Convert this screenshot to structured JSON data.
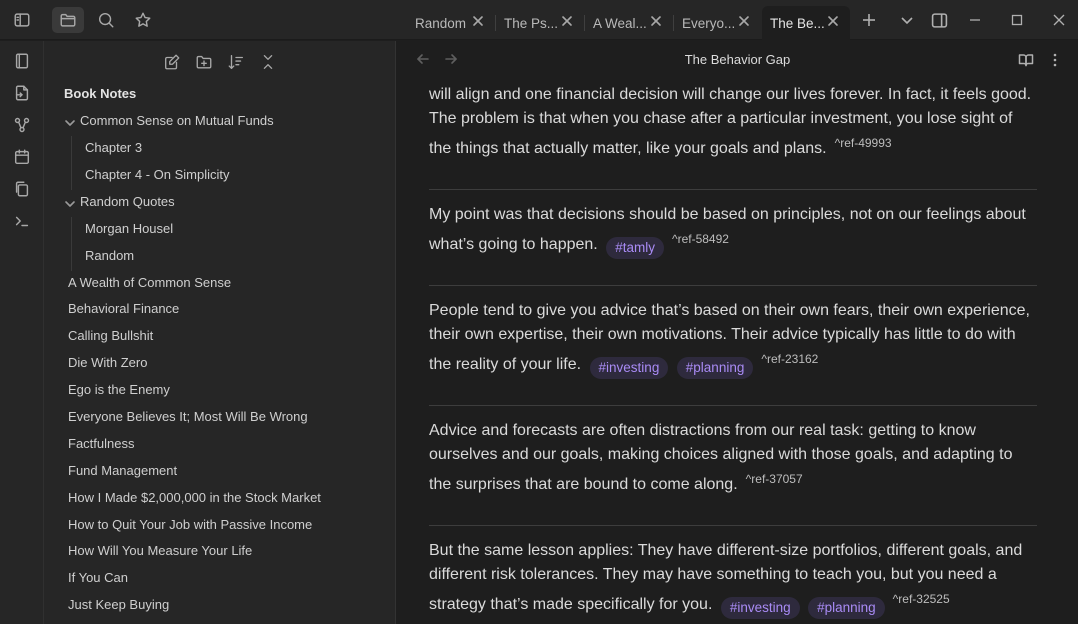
{
  "tabs": [
    {
      "label": "Random"
    },
    {
      "label": "The Ps..."
    },
    {
      "label": "A Weal..."
    },
    {
      "label": "Everyo..."
    },
    {
      "label": "The Be..."
    }
  ],
  "sidebar": {
    "root": "Book Notes",
    "items": [
      "Common Sense on Mutual Funds",
      "Chapter 3",
      "Chapter 4 - On Simplicity",
      "Random Quotes",
      "Morgan Housel",
      "Random",
      "A Wealth of Common Sense",
      "Behavioral Finance",
      "Calling Bullshit",
      "Die With Zero",
      "Ego is the Enemy",
      "Everyone Believes It; Most Will Be Wrong",
      "Factfulness",
      "Fund Management",
      "How I Made $2,000,000 in the Stock Market",
      "How to Quit Your Job with Passive Income",
      "How Will You Measure Your Life",
      "If You Can",
      "Just Keep Buying"
    ]
  },
  "main": {
    "title": "The Behavior Gap",
    "paragraphs": [
      {
        "text": "will align and one financial decision will change our lives forever. In fact, it feels good. The problem is that when you chase after a particular investment, you lose sight of the things that actually matter, like your goals and plans.",
        "tags": [],
        "ref": "^ref-49993"
      },
      {
        "text": "My point was that decisions should be based on principles, not on our feelings about what’s going to happen.",
        "tags": [
          "#tamly"
        ],
        "ref": "^ref-58492"
      },
      {
        "text": "People tend to give you advice that’s based on their own fears, their own experience, their own expertise, their own motivations. Their advice typically has little to do with the reality of your life.",
        "tags": [
          "#investing",
          "#planning"
        ],
        "ref": "^ref-23162"
      },
      {
        "text": "Advice and forecasts are often distractions from our real task: getting to know ourselves and our goals, making choices aligned with those goals, and adapting to the surprises that are bound to come along.",
        "tags": [],
        "ref": "^ref-37057"
      },
      {
        "text": "But the same lesson applies: They have different-size portfolios, different goals, and different risk tolerances. They may have something to teach you, but you need a strategy that’s made specifically for you.",
        "tags": [
          "#investing",
          "#planning"
        ],
        "ref": "^ref-32525"
      }
    ]
  },
  "colors": {
    "tag_text": "#a98bf5",
    "tag_bg": "#2e2a3d",
    "background": "#1e1e1e",
    "panel": "#262626"
  },
  "icons": {
    "topbar": [
      "sidebar-toggle-icon",
      "folder-icon",
      "search-icon",
      "star-icon",
      "new-tab-icon",
      "chevron-down-icon",
      "split-icon",
      "minimize-icon",
      "maximize-icon",
      "close-icon"
    ],
    "ribbon": [
      "files-icon",
      "open-file-icon",
      "graph-icon",
      "calendar-icon",
      "copy-icon",
      "terminal-icon"
    ],
    "sidebar_tools": [
      "new-note-icon",
      "new-folder-icon",
      "sort-icon",
      "collapse-icon"
    ],
    "editor": [
      "back-arrow-icon",
      "forward-arrow-icon",
      "reading-view-icon",
      "more-options-icon"
    ]
  }
}
